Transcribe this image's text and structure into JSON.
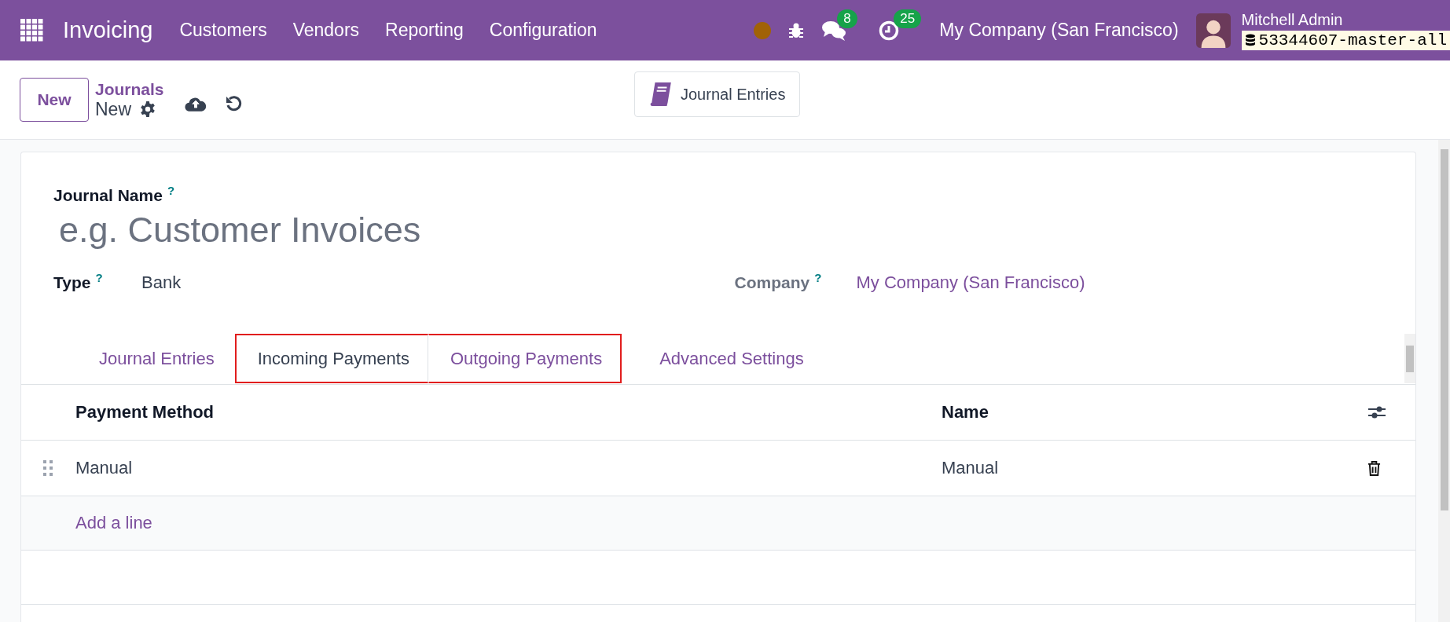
{
  "navbar": {
    "app_name": "Invoicing",
    "menu": [
      "Customers",
      "Vendors",
      "Reporting",
      "Configuration"
    ],
    "messages_count": "8",
    "activities_count": "25",
    "company": "My Company (San Francisco)",
    "user_name": "Mitchell Admin",
    "database": "53344607-master-all"
  },
  "control_panel": {
    "new_button": "New",
    "breadcrumb": "Journals",
    "record": "New",
    "smart_button": "Journal Entries"
  },
  "form": {
    "name_label": "Journal Name",
    "name_help": "?",
    "name_placeholder": "e.g. Customer Invoices",
    "fields": [
      {
        "label": "Type",
        "help": "?",
        "value": "Bank",
        "kind": "text"
      },
      {
        "label": "Company",
        "help": "?",
        "value": "My Company (San Francisco)",
        "kind": "link"
      }
    ],
    "tabs": [
      {
        "label": "Journal Entries",
        "selected": false,
        "highlighted": false
      },
      {
        "label": "Incoming Payments",
        "selected": true,
        "highlighted": true
      },
      {
        "label": "Outgoing Payments",
        "selected": false,
        "highlighted": true
      },
      {
        "label": "Advanced Settings",
        "selected": false,
        "highlighted": false
      }
    ],
    "table": {
      "columns": [
        "Payment Method",
        "Name"
      ],
      "rows": [
        {
          "payment_method": "Manual",
          "name": "Manual"
        }
      ],
      "add_line": "Add a line"
    }
  }
}
